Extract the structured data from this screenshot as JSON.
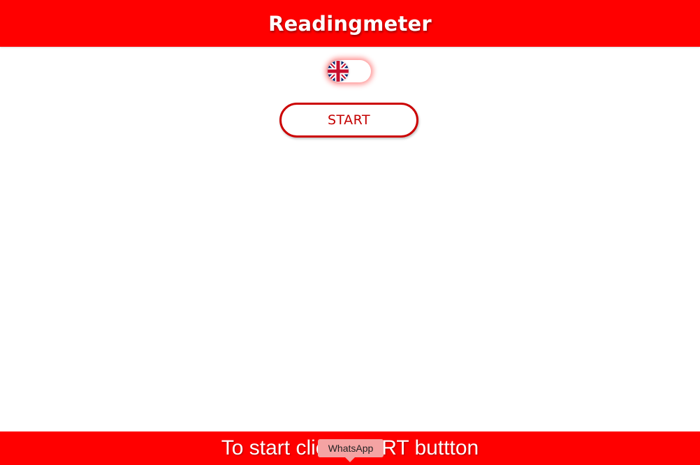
{
  "header": {
    "title": "Readingmeter"
  },
  "language_toggle": {
    "icon": "uk-flag-icon",
    "selected": "English"
  },
  "main": {
    "start_label": "START"
  },
  "footer": {
    "instruction_text": "To start click START buttton"
  },
  "tooltip": {
    "label": "WhatsApp"
  },
  "colors": {
    "brand_red": "#ff0000",
    "button_border": "#cc0000",
    "button_text": "#c40000",
    "tooltip_bg": "#f4a3a3"
  }
}
